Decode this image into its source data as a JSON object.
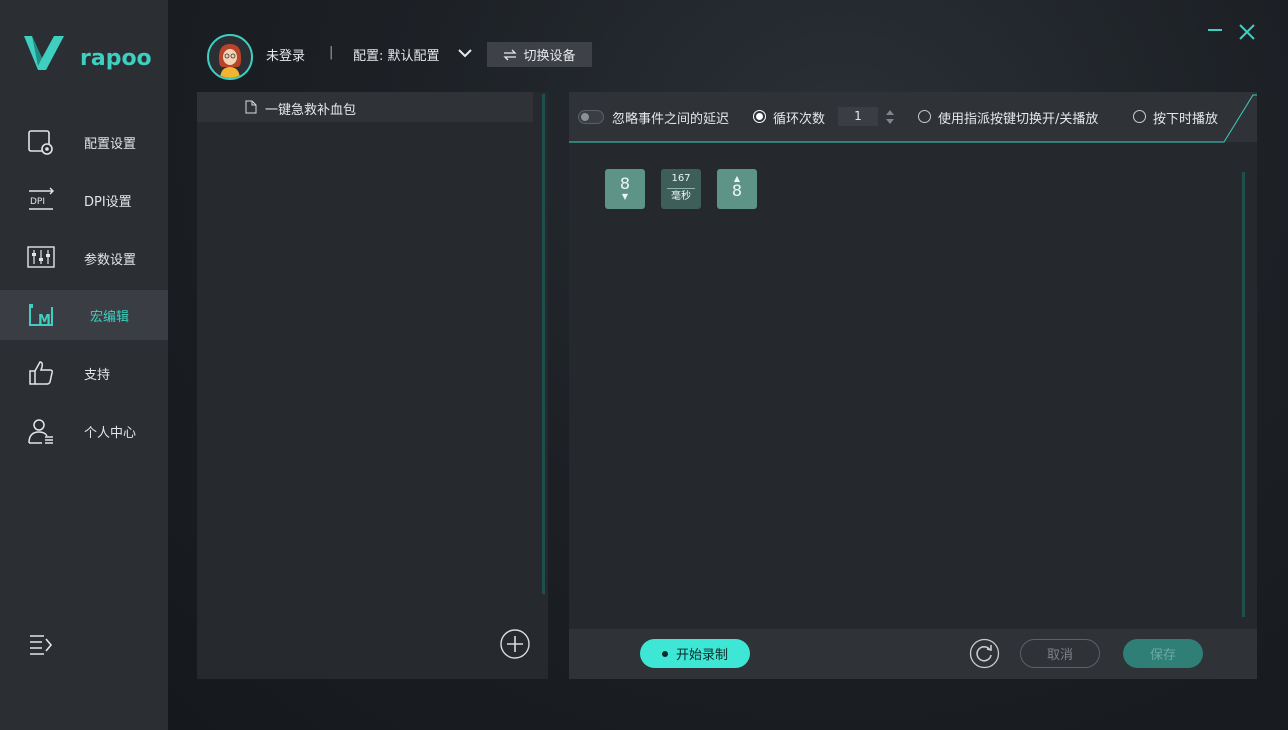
{
  "brand": {
    "name": "rapoo",
    "accent": "#3ecfc0"
  },
  "sidebar": {
    "items": [
      {
        "label": "配置设置",
        "icon": "config-settings-icon"
      },
      {
        "label": "DPI设置",
        "icon": "dpi-icon"
      },
      {
        "label": "参数设置",
        "icon": "sliders-icon"
      },
      {
        "label": "宏编辑",
        "icon": "macro-icon",
        "active": true
      },
      {
        "label": "支持",
        "icon": "thumbs-up-icon"
      },
      {
        "label": "个人中心",
        "icon": "user-center-icon"
      }
    ],
    "collapse_icon": "menu-collapse-icon"
  },
  "header": {
    "user_name": "未登录",
    "separator": "|",
    "config_label": "配置: 默认配置",
    "switch_device_label": "切换设备"
  },
  "macro_list": {
    "items": [
      {
        "label": "一键急救补血包"
      }
    ]
  },
  "options": {
    "ignore_delay_label": "忽略事件之间的延迟",
    "loop_label": "循环次数",
    "loop_count": "1",
    "toggle_assign_label": "使用指派按键切换开/关播放",
    "press_play_label": "按下时播放"
  },
  "events": [
    {
      "type": "key_down",
      "key": "8",
      "arrow": "▼"
    },
    {
      "type": "delay",
      "value": "167",
      "unit": "毫秒"
    },
    {
      "type": "key_up",
      "key": "8",
      "arrow": "▲"
    }
  ],
  "bottom": {
    "record_label": "开始录制",
    "cancel_label": "取消",
    "save_label": "保存"
  }
}
